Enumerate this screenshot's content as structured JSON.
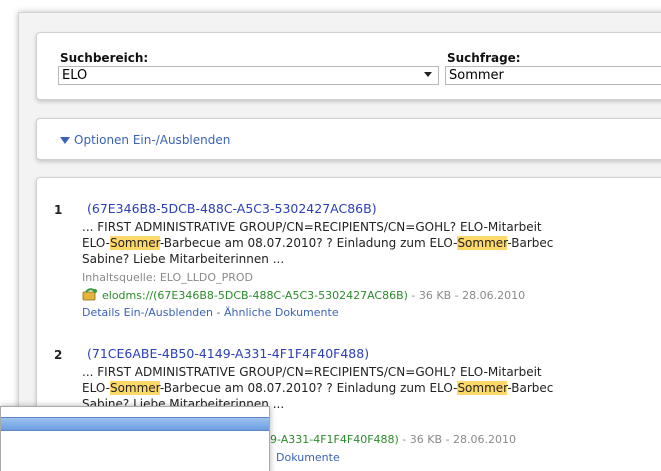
{
  "search": {
    "area_label": "Suchbereich:",
    "area_value": "ELO",
    "query_label": "Suchfrage:",
    "query_value": "Sommer"
  },
  "options": {
    "toggle_label": "Optionen Ein-/Ausblenden"
  },
  "results": [
    {
      "index": "1",
      "title": "(67E346B8-5DCB-488C-A5C3-5302427AC86B)",
      "line1": "... FIRST ADMINISTRATIVE GROUP/CN=RECIPIENTS/CN=GOHL? ELO-Mitarbeit",
      "line2_pre": "ELO-",
      "line2_hl1": "Sommer",
      "line2_mid": "-Barbecue am 08.07.2010? ? Einladung zum ELO-",
      "line2_hl2": "Sommer",
      "line2_post": "-Barbec",
      "line3": "Sabine? Liebe Mitarbeiterinnen ...",
      "source": "Inhaltsquelle: ELO_LLDO_PROD",
      "link": "elodms://(67E346B8-5DCB-488C-A5C3-5302427AC86B)",
      "meta": " - 36 KB - 28.06.2010",
      "details": "Details Ein-/Ausblenden",
      "sep": " - ",
      "similar": "Ähnliche Dokumente"
    },
    {
      "index": "2",
      "title": "(71CE6ABE-4B50-4149-A331-4F1F4F40F488)",
      "line1": "... FIRST ADMINISTRATIVE GROUP/CN=RECIPIENTS/CN=GOHL? ELO-Mitarbeit",
      "line2_pre": "ELO-",
      "line2_hl1": "Sommer",
      "line2_mid": "-Barbecue am 08.07.2010? ? Einladung zum ELO-",
      "line2_hl2": "Sommer",
      "line2_post": "-Barbec",
      "line3": "Sabine? Liebe Mitarbeiterinnen ...",
      "link_partial": "9-A331-4F1F4F40F488)",
      "meta": " - 36 KB - 28.06.2010",
      "similar": "Dokumente"
    }
  ],
  "colors": {
    "link": "#3a63b7",
    "title": "#2b3fb6",
    "green": "#2c8a2c",
    "highlight": "#ffd86a"
  },
  "icons": [
    "dropdown-arrow-icon",
    "expand-triangle-icon",
    "document-link-icon"
  ]
}
